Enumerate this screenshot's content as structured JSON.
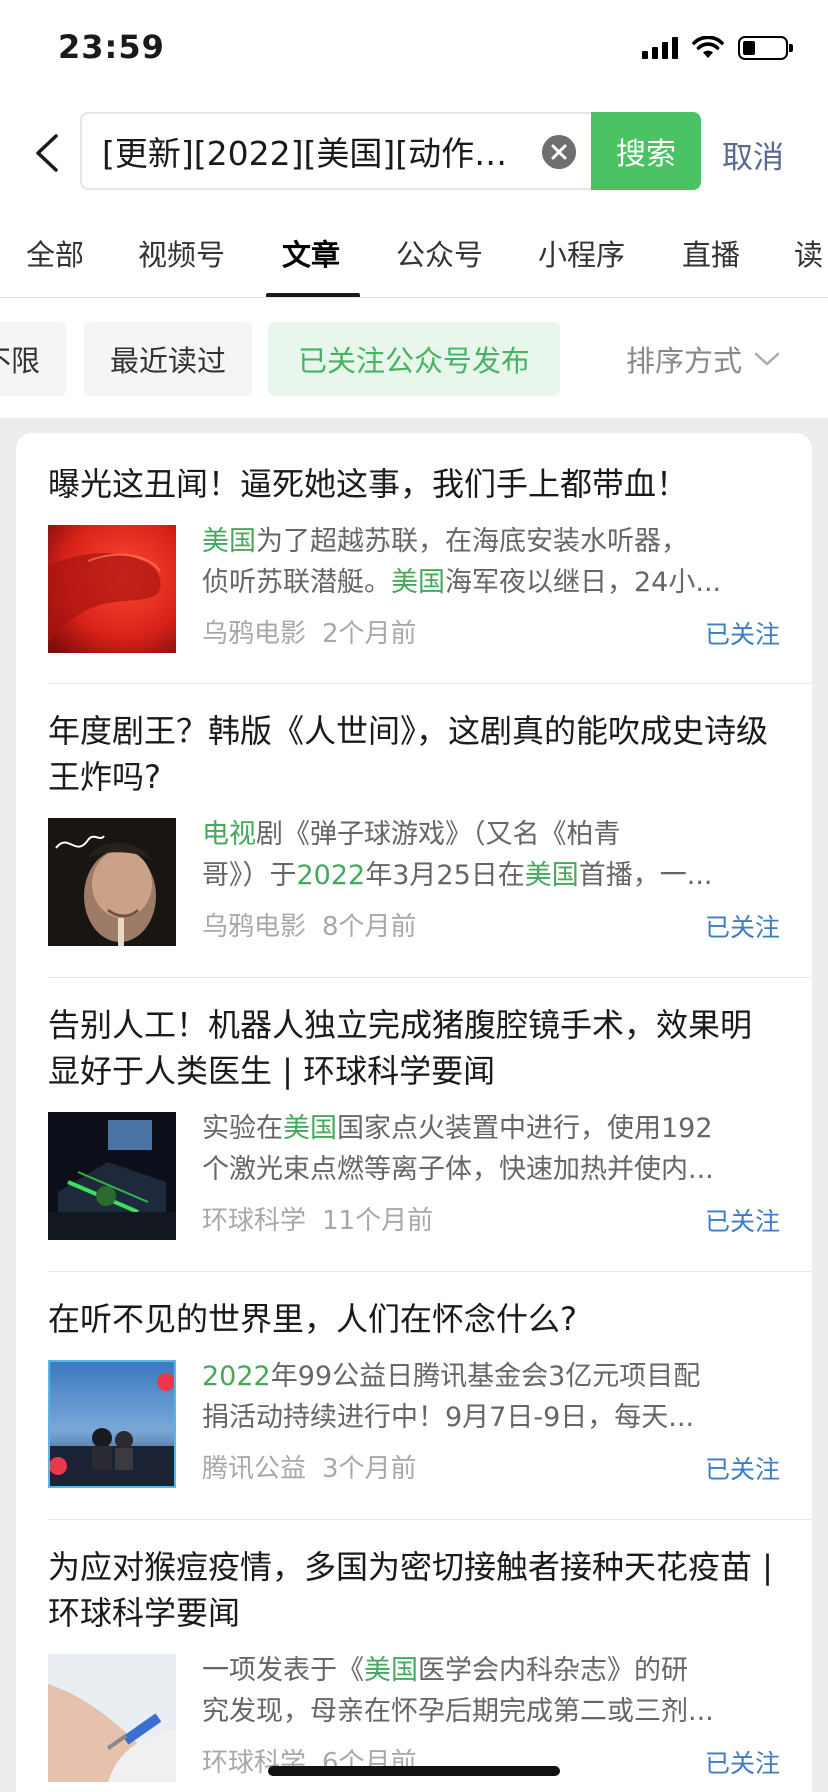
{
  "status_bar": {
    "time": "23:59"
  },
  "search": {
    "query": "[更新][2022][美国][动作]...",
    "button_label": "搜索",
    "cancel_label": "取消"
  },
  "tabs": [
    {
      "label": "全部"
    },
    {
      "label": "视频号"
    },
    {
      "label": "文章"
    },
    {
      "label": "公众号"
    },
    {
      "label": "小程序"
    },
    {
      "label": "直播"
    },
    {
      "label": "读"
    }
  ],
  "active_tab": "文章",
  "filters": [
    {
      "label": "不限"
    },
    {
      "label": "最近读过"
    },
    {
      "label": "已关注公众号发布"
    }
  ],
  "sort_label": "排序方式",
  "highlight_color": "#45a85a",
  "followed_color": "#3e7cc6",
  "accent_green": "#4bc264",
  "results": [
    {
      "title": "曝光这丑闻！逼死她这事，我们手上都带血！",
      "line1": [
        {
          "t": "美国",
          "h": true
        },
        {
          "t": "为了超越苏联，在海底安装水听器，",
          "h": false
        }
      ],
      "line2": [
        {
          "t": "侦听苏联潜艇。",
          "h": false
        },
        {
          "t": "美国",
          "h": true
        },
        {
          "t": "海军夜以继日，24小...",
          "h": false
        }
      ],
      "source": "乌鸦电影",
      "time": "2个月前",
      "followed": "已关注"
    },
    {
      "title": "年度剧王？韩版《人世间》，这剧真的能吹成史诗级王炸吗?",
      "line1": [
        {
          "t": "电视",
          "h": true
        },
        {
          "t": "剧《弹子球游戏》（又名《柏青",
          "h": false
        }
      ],
      "line2": [
        {
          "t": "哥》）于",
          "h": false
        },
        {
          "t": "2022",
          "h": true
        },
        {
          "t": "年3月25日在",
          "h": false
        },
        {
          "t": "美国",
          "h": true
        },
        {
          "t": "首播，一...",
          "h": false
        }
      ],
      "source": "乌鸦电影",
      "time": "8个月前",
      "followed": "已关注"
    },
    {
      "title": "告别人工！机器人独立完成猪腹腔镜手术，效果明显好于人类医生 | 环球科学要闻",
      "line1": [
        {
          "t": "实验在",
          "h": false
        },
        {
          "t": "美国",
          "h": true
        },
        {
          "t": "国家点火装置中进行，使用192",
          "h": false
        }
      ],
      "line2": [
        {
          "t": "个激光束点燃等离子体，快速加热并使内...",
          "h": false
        }
      ],
      "source": "环球科学",
      "time": "11个月前",
      "followed": "已关注"
    },
    {
      "title": "在听不见的世界里，人们在怀念什么?",
      "line1": [
        {
          "t": "2022",
          "h": true
        },
        {
          "t": "年99公益日腾讯基金会3亿元项目配",
          "h": false
        }
      ],
      "line2": [
        {
          "t": "捐活动持续进行中！9月7日-9日，每天...",
          "h": false
        }
      ],
      "source": "腾讯公益",
      "time": "3个月前",
      "followed": "已关注"
    },
    {
      "title": "为应对猴痘疫情，多国为密切接触者接种天花疫苗 | 环球科学要闻",
      "line1": [
        {
          "t": "一项发表于《",
          "h": false
        },
        {
          "t": "美国",
          "h": true
        },
        {
          "t": "医学会内科杂志》的研",
          "h": false
        }
      ],
      "line2": [
        {
          "t": "究发现，母亲在怀孕后期完成第二或三剂...",
          "h": false
        }
      ],
      "source": "环球科学",
      "time": "6个月前",
      "followed": "已关注"
    }
  ]
}
